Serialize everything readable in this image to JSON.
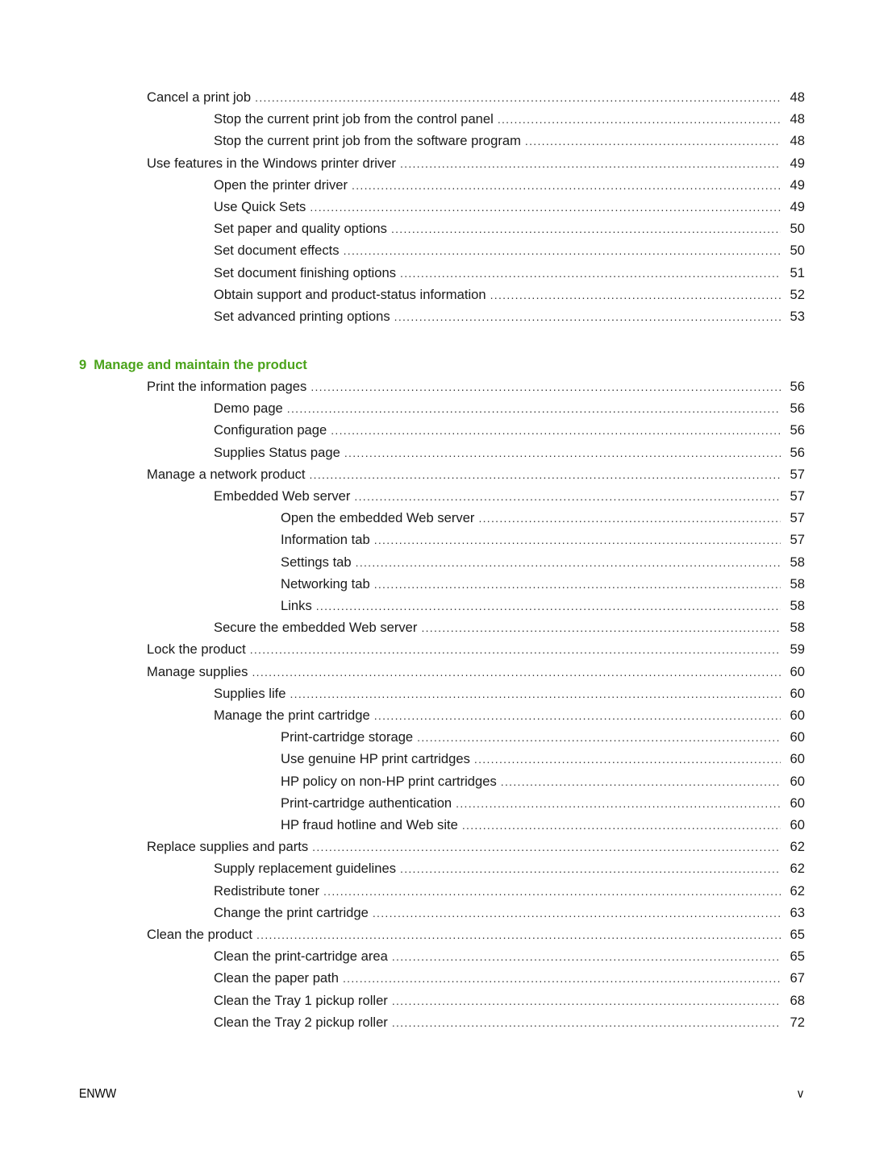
{
  "sections": [
    {
      "entries": [
        {
          "level": 1,
          "title": "Cancel a print job",
          "page": "48"
        },
        {
          "level": 2,
          "title": "Stop the current print job from the control panel",
          "page": "48"
        },
        {
          "level": 2,
          "title": "Stop the current print job from the software program",
          "page": "48"
        },
        {
          "level": 1,
          "title": "Use features in the Windows printer driver",
          "page": "49"
        },
        {
          "level": 2,
          "title": "Open the printer driver",
          "page": "49"
        },
        {
          "level": 2,
          "title": "Use Quick Sets",
          "page": "49"
        },
        {
          "level": 2,
          "title": "Set paper and quality options",
          "page": "50"
        },
        {
          "level": 2,
          "title": "Set document effects",
          "page": "50"
        },
        {
          "level": 2,
          "title": "Set document finishing options",
          "page": "51"
        },
        {
          "level": 2,
          "title": "Obtain support and product-status information",
          "page": "52"
        },
        {
          "level": 2,
          "title": "Set advanced printing options",
          "page": "53"
        }
      ]
    }
  ],
  "chapter": {
    "number": "9",
    "title": "Manage and maintain the product",
    "color": "#4aa31a"
  },
  "chapter_entries": [
    {
      "level": 1,
      "title": "Print the information pages",
      "page": "56"
    },
    {
      "level": 2,
      "title": "Demo page",
      "page": "56"
    },
    {
      "level": 2,
      "title": "Configuration page",
      "page": "56"
    },
    {
      "level": 2,
      "title": "Supplies Status page",
      "page": "56"
    },
    {
      "level": 1,
      "title": "Manage a network product",
      "page": "57"
    },
    {
      "level": 2,
      "title": "Embedded Web server",
      "page": "57"
    },
    {
      "level": 3,
      "title": "Open the embedded Web server",
      "page": "57"
    },
    {
      "level": 3,
      "title": "Information tab",
      "page": "57"
    },
    {
      "level": 3,
      "title": "Settings tab",
      "page": "58"
    },
    {
      "level": 3,
      "title": "Networking tab",
      "page": "58"
    },
    {
      "level": 3,
      "title": "Links",
      "page": "58"
    },
    {
      "level": 2,
      "title": "Secure the embedded Web server",
      "page": "58"
    },
    {
      "level": 1,
      "title": "Lock the product",
      "page": "59"
    },
    {
      "level": 1,
      "title": "Manage supplies",
      "page": "60"
    },
    {
      "level": 2,
      "title": "Supplies life",
      "page": "60"
    },
    {
      "level": 2,
      "title": "Manage the print cartridge",
      "page": "60"
    },
    {
      "level": 3,
      "title": "Print-cartridge storage",
      "page": "60"
    },
    {
      "level": 3,
      "title": "Use genuine HP print cartridges",
      "page": "60"
    },
    {
      "level": 3,
      "title": "HP policy on non-HP print cartridges",
      "page": "60"
    },
    {
      "level": 3,
      "title": "Print-cartridge authentication",
      "page": "60"
    },
    {
      "level": 3,
      "title": "HP fraud hotline and Web site",
      "page": "60"
    },
    {
      "level": 1,
      "title": "Replace supplies and parts",
      "page": "62"
    },
    {
      "level": 2,
      "title": "Supply replacement guidelines",
      "page": "62"
    },
    {
      "level": 2,
      "title": "Redistribute toner",
      "page": "62"
    },
    {
      "level": 2,
      "title": "Change the print cartridge",
      "page": "63"
    },
    {
      "level": 1,
      "title": "Clean the product",
      "page": "65"
    },
    {
      "level": 2,
      "title": "Clean the print-cartridge area",
      "page": "65"
    },
    {
      "level": 2,
      "title": "Clean the paper path",
      "page": "67"
    },
    {
      "level": 2,
      "title": "Clean the Tray 1 pickup roller",
      "page": "68"
    },
    {
      "level": 2,
      "title": "Clean the Tray 2 pickup roller",
      "page": "72"
    }
  ],
  "footer": {
    "left": "ENWW",
    "right": "v"
  }
}
